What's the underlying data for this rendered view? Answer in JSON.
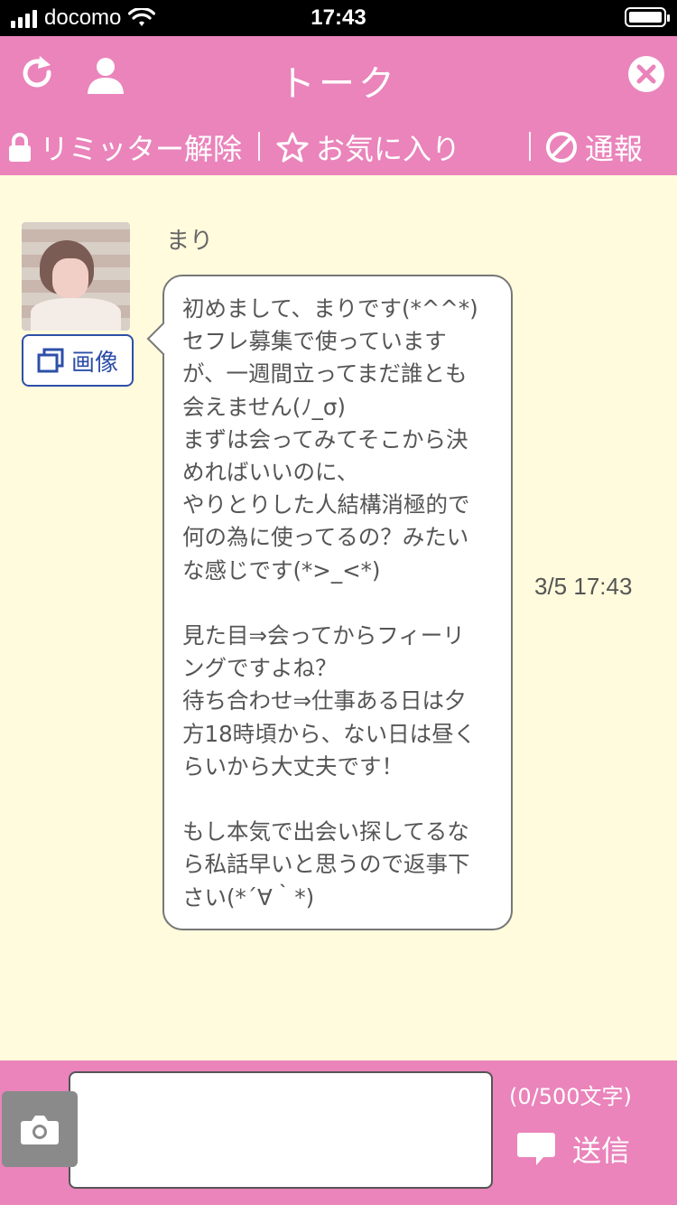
{
  "status_bar": {
    "carrier": "docomo",
    "time": "17:43"
  },
  "header": {
    "title": "トーク",
    "subnav": {
      "limiter": "リミッター解除",
      "favorite": "お気に入り",
      "report": "通報"
    }
  },
  "chat": {
    "sender_name": "まり",
    "image_button": "画像",
    "message": "初めまして、まりです(*^^*)\nセフレ募集で使っています\nが、一週間立ってまだ誰とも\n会えません(ﾉ_σ)\nまずは会ってみてそこから決\nめればいいのに、\nやりとりした人結構消極的で\n何の為に使ってるの？みたい\nな感じです(*>_<*)\n\n見た目⇒会ってからフィーリ\nングですよね？\n待ち合わせ⇒仕事ある日は夕\n方18時頃から、ない日は昼く\nらいから大丈夫です！\n\nもし本気で出会い探してるな\nら私話早いと思うので返事下\nさい(*´∀｀*)",
    "timestamp": "3/5 17:43"
  },
  "footer": {
    "input_value": "",
    "char_counter": "(0/500文字)",
    "send_label": "送信"
  },
  "colors": {
    "header_pink": "#ea84bb",
    "chat_background": "#fffbdc",
    "image_button_blue": "#2d4fa8",
    "camera_button_gray": "#8a8a8a"
  }
}
